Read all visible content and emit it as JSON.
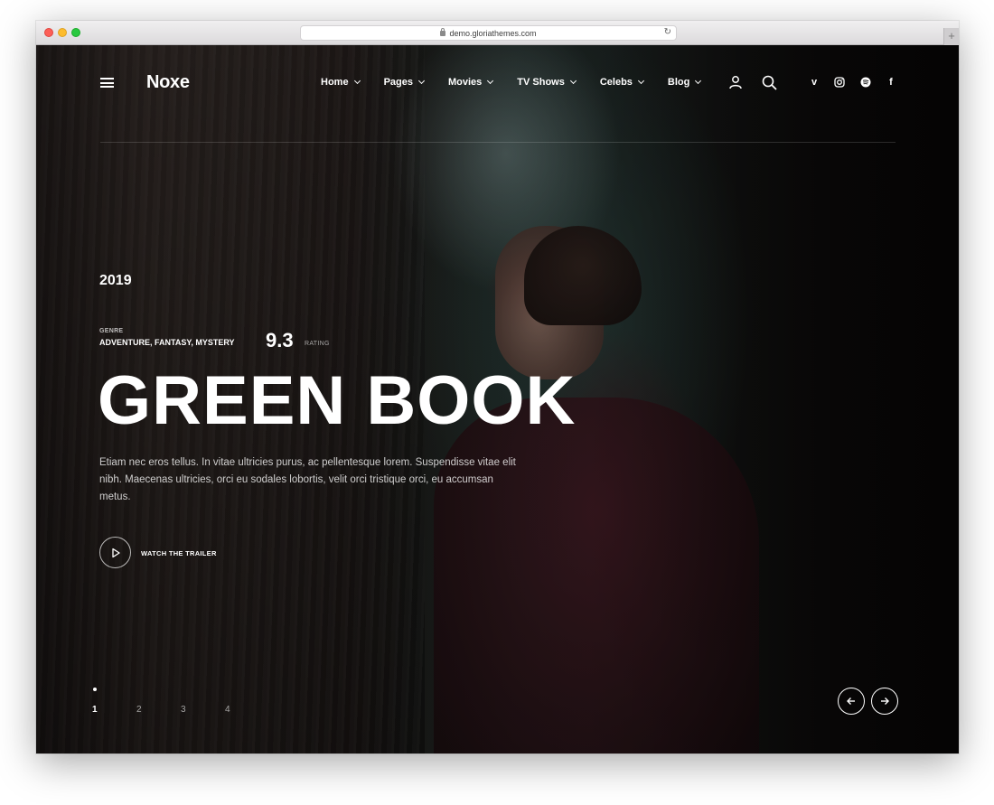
{
  "browser": {
    "url": "demo.gloriathemes.com",
    "reload_glyph": "↻",
    "new_tab_glyph": "+"
  },
  "header": {
    "menu_icon": "hamburger-icon",
    "logo": "Noxe",
    "nav": [
      {
        "label": "Home",
        "icon": "chevron-down-icon"
      },
      {
        "label": "Pages",
        "icon": "chevron-down-icon"
      },
      {
        "label": "Movies",
        "icon": "chevron-down-icon"
      },
      {
        "label": "TV Shows",
        "icon": "chevron-down-icon"
      },
      {
        "label": "Celebs",
        "icon": "chevron-down-icon"
      },
      {
        "label": "Blog",
        "icon": "chevron-down-icon"
      }
    ],
    "actions": [
      "user-icon",
      "search-icon"
    ],
    "social": [
      {
        "name": "vimeo-icon",
        "glyph": "v"
      },
      {
        "name": "instagram-icon",
        "glyph": ""
      },
      {
        "name": "spotify-icon",
        "glyph": ""
      },
      {
        "name": "facebook-icon",
        "glyph": "f"
      }
    ]
  },
  "hero": {
    "year": "2019",
    "genre_label": "GENRE",
    "genre_value": "ADVENTURE, FANTASY, MYSTERY",
    "rating_value": "9.3",
    "rating_label": "RATING",
    "title": "GREEN BOOK",
    "description": "Etiam nec eros tellus. In vitae ultricies purus, ac pellentesque lorem. Suspendisse vitae elit nibh. Maecenas ultricies, orci eu sodales lobortis, velit orci tristique orci, eu accumsan metus.",
    "trailer_label": "WATCH THE TRAILER"
  },
  "slider": {
    "pages": [
      "1",
      "2",
      "3",
      "4"
    ],
    "active_page": "1",
    "prev_glyph": "←",
    "next_glyph": "→"
  },
  "colors": {
    "text": "#ffffff",
    "background": "#0c0a0a"
  }
}
